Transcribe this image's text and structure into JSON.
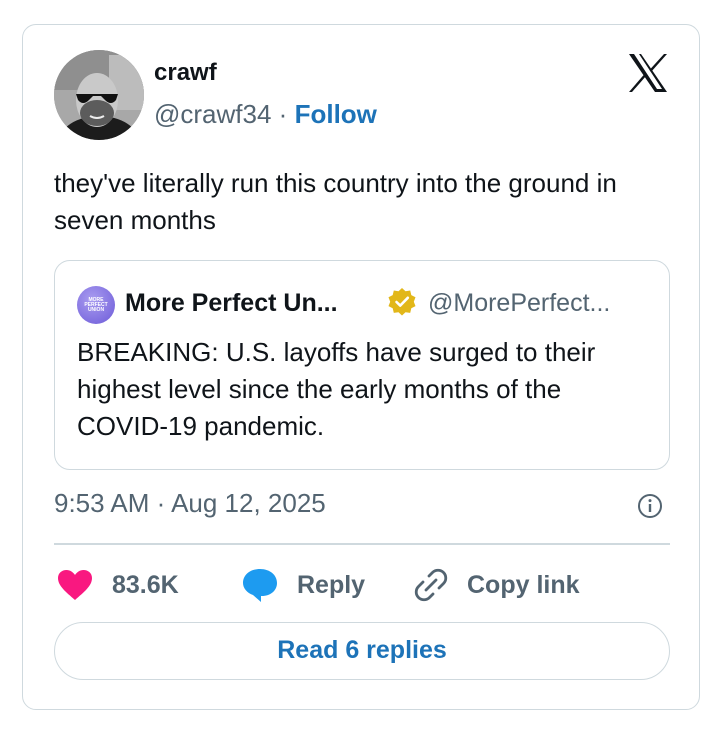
{
  "author": {
    "display_name": "crawf",
    "handle": "@crawf34",
    "separator": "·",
    "follow_label": "Follow"
  },
  "tweet": {
    "text": "they've literally run this country into the ground in seven months",
    "timestamp": "9:53 AM · Aug 12, 2025"
  },
  "quoted_tweet": {
    "avatar_text": [
      "MORE",
      "PERFECT",
      "UNION"
    ],
    "display_name": "More Perfect Un...",
    "handle": "@MorePerfect...",
    "text": "BREAKING: U.S. layoffs have surged to their highest level since the early months of the COVID-19 pandemic."
  },
  "actions": {
    "like_count": "83.6K",
    "reply_label": "Reply",
    "copy_link_label": "Copy link",
    "read_replies_label": "Read 6 replies"
  },
  "icons": {
    "brand": "x-logo-icon",
    "verified": "verified-badge-icon",
    "info": "info-icon",
    "like": "heart-icon",
    "reply": "speech-bubble-icon",
    "copy": "link-icon"
  },
  "colors": {
    "link_blue": "#1d73b8",
    "heart_pink": "#f91880",
    "reply_blue": "#1d9bf0",
    "verified_gold": "#e2b719",
    "border": "#cfd9de",
    "secondary_text": "#536471"
  }
}
